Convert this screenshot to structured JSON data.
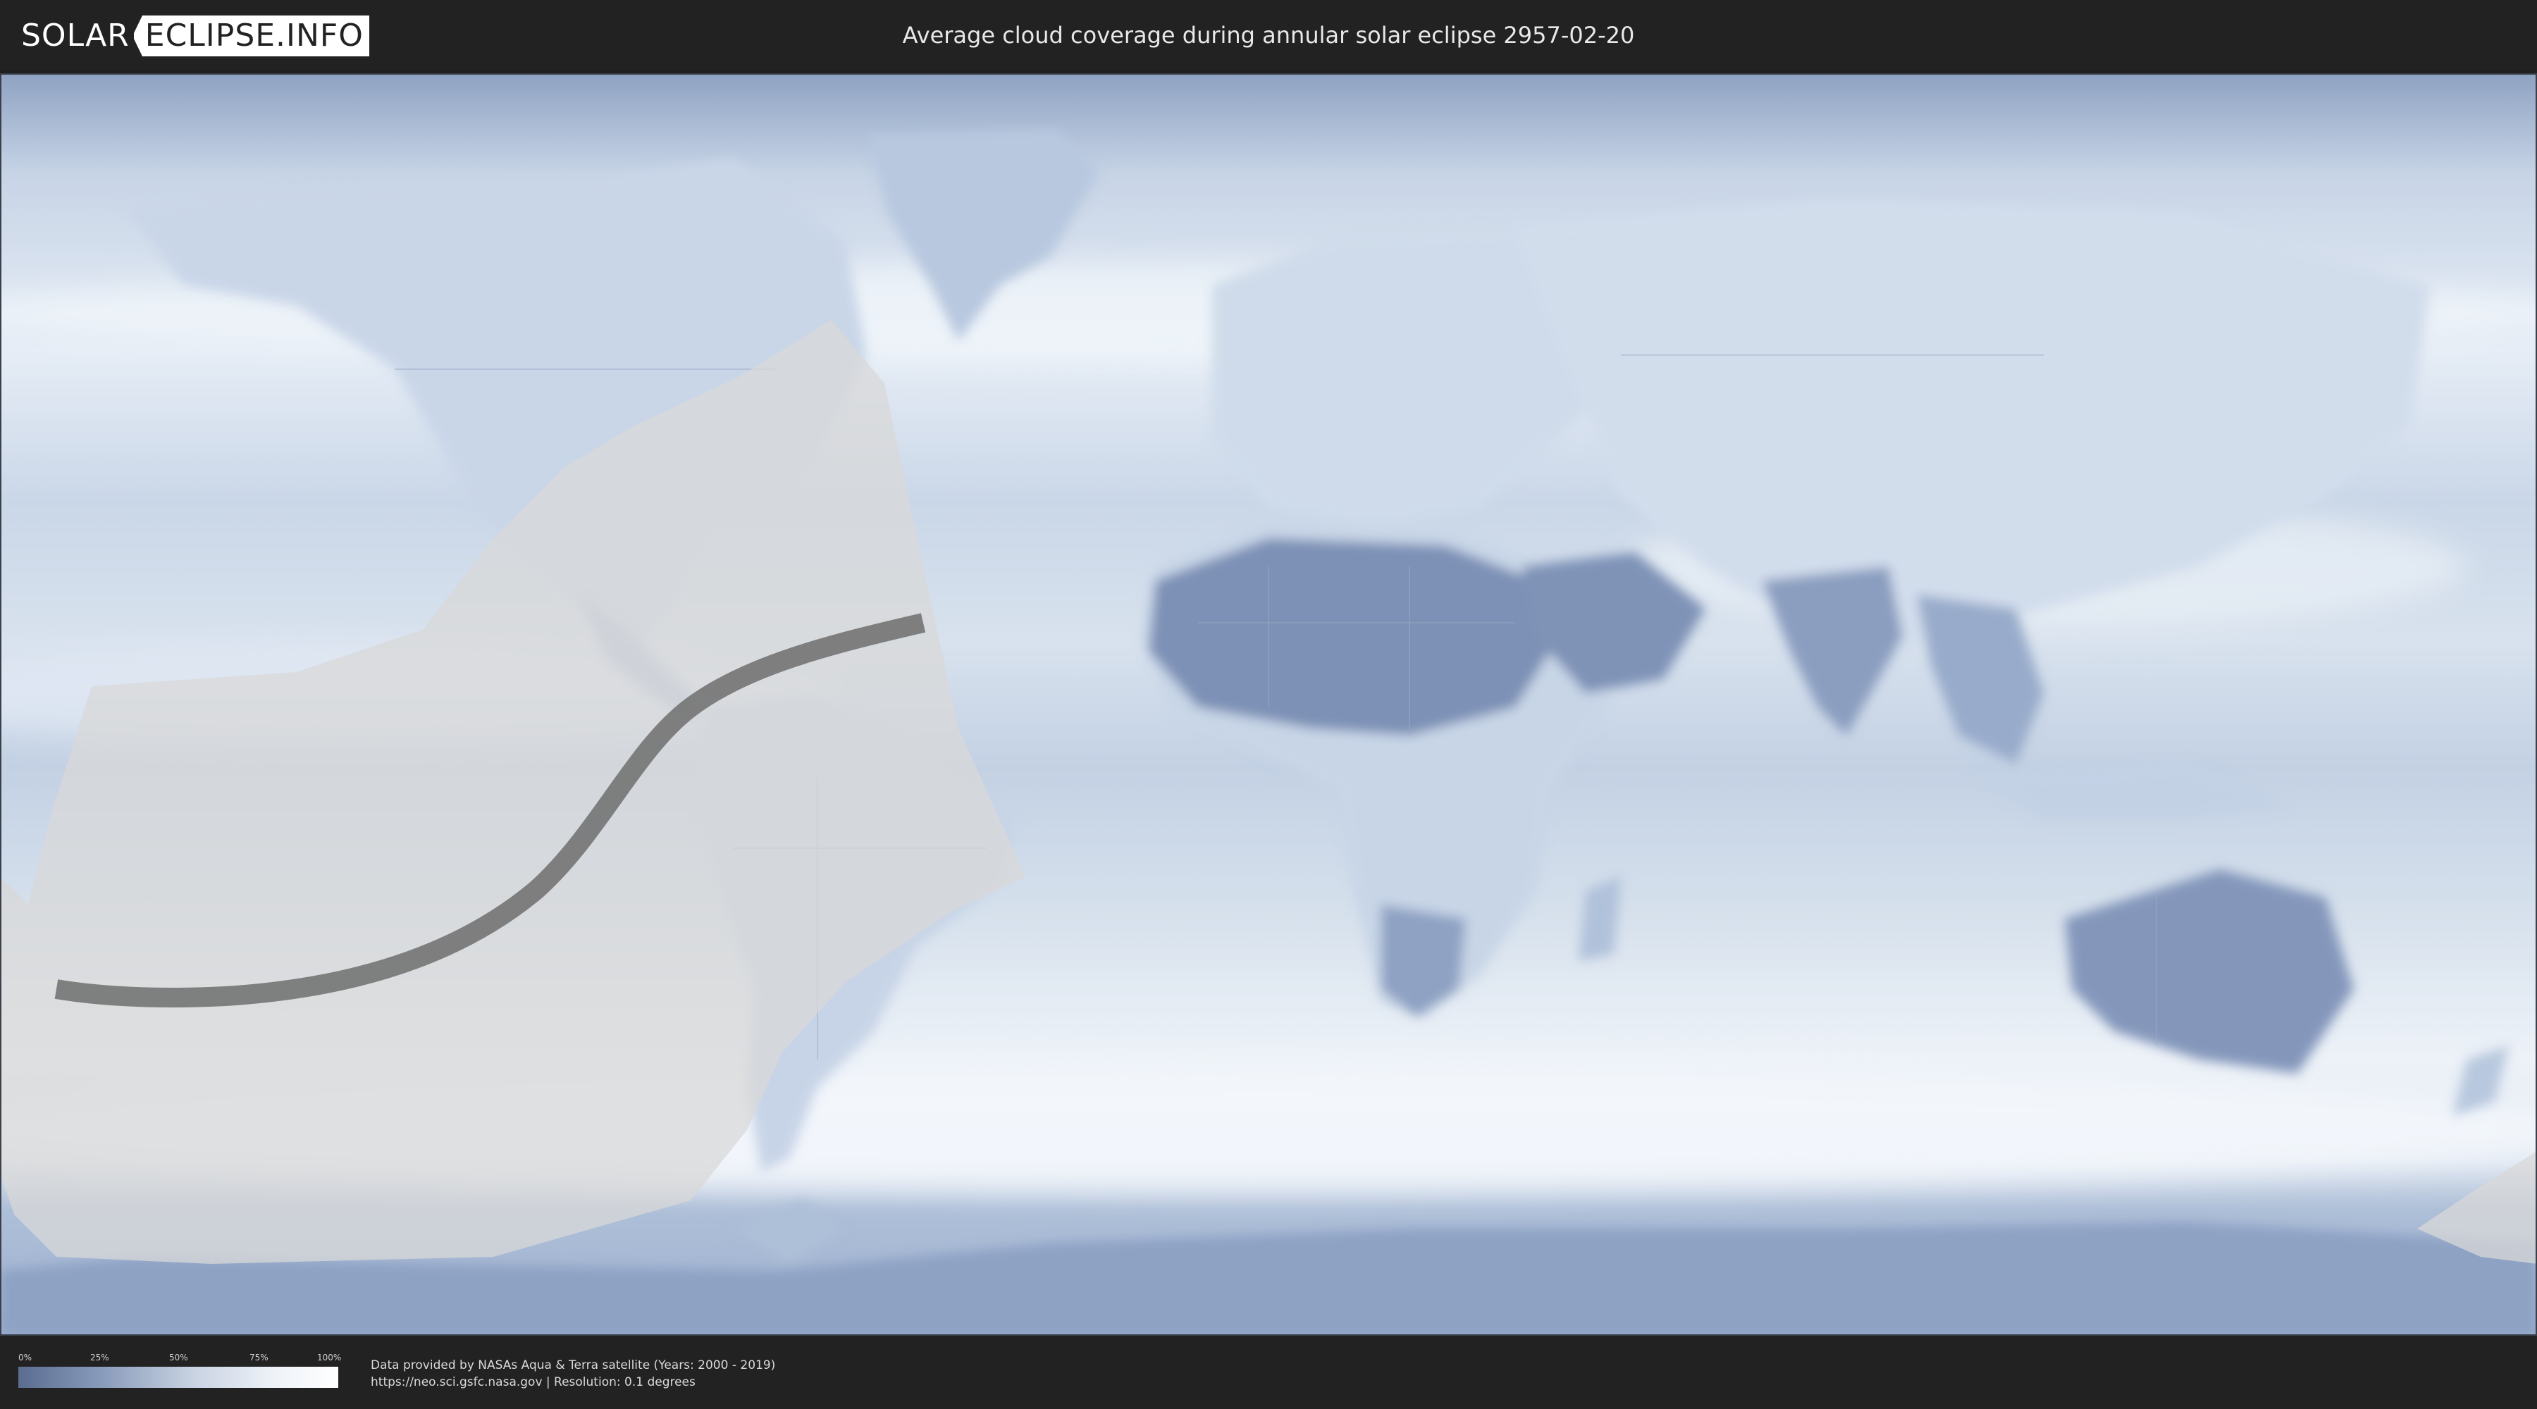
{
  "header": {
    "logo_left": "SOLAR",
    "logo_right": "ECLIPSE.INFO",
    "title": "Average cloud coverage during annular solar eclipse 2957-02-20"
  },
  "legend": {
    "ticks": [
      "0%",
      "25%",
      "50%",
      "75%",
      "100%"
    ]
  },
  "footer": {
    "credit_line1": "Data provided by NASAs Aqua & Terra satellite (Years: 2000 - 2019)",
    "credit_line2": "https://neo.sci.gsfc.nasa.gov | Resolution: 0.1 degrees"
  },
  "map": {
    "colors": {
      "ocean_cloud": "#dbe5f0",
      "clear_land": "#7b8fb5",
      "heavy_cloud": "#f3f6fb",
      "eclipse_zone": "#d9d9d9",
      "central_path": "#6e6e6e"
    }
  }
}
